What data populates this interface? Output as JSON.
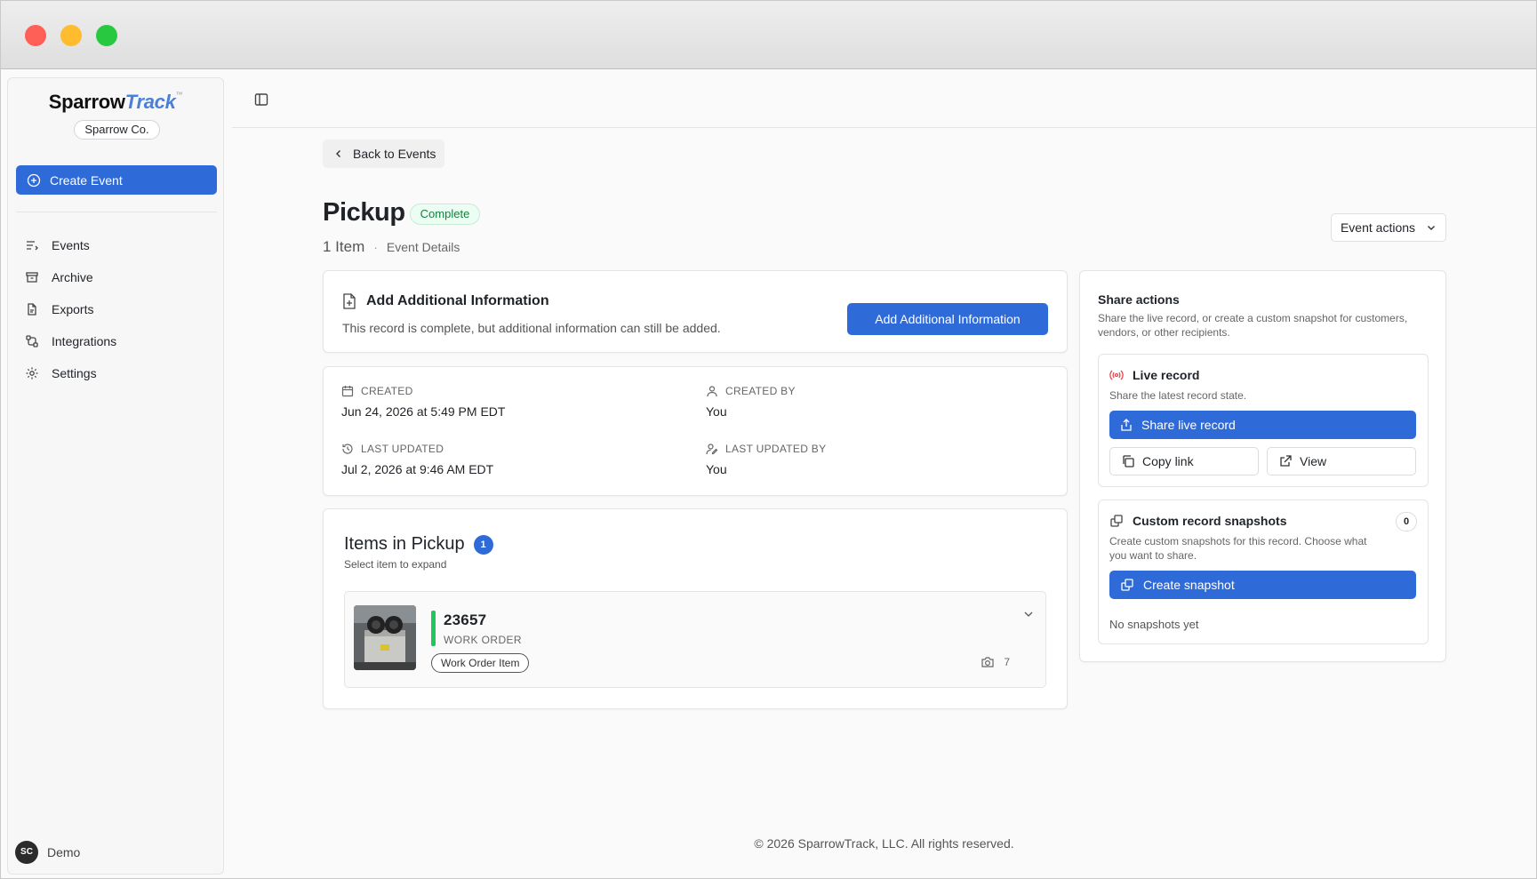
{
  "brand": {
    "name_part1": "Sparrow",
    "name_part2": "Track",
    "trademark": "™",
    "org": "Sparrow Co."
  },
  "sidebar": {
    "create_label": "Create Event",
    "items": [
      {
        "label": "Events",
        "icon": "list-icon"
      },
      {
        "label": "Archive",
        "icon": "archive-icon"
      },
      {
        "label": "Exports",
        "icon": "export-file-icon"
      },
      {
        "label": "Integrations",
        "icon": "integrations-icon"
      },
      {
        "label": "Settings",
        "icon": "gear-icon"
      }
    ],
    "user": {
      "initials": "SC",
      "name": "Demo"
    }
  },
  "header": {
    "back_label": "Back to Events",
    "title": "Pickup",
    "status": "Complete",
    "item_count": "1 Item",
    "separator": "·",
    "subtitle": "Event Details",
    "actions_label": "Event actions"
  },
  "info_card": {
    "title": "Add Additional Information",
    "description": "This record is complete, but additional information can still be added.",
    "button_label": "Add Additional Information"
  },
  "meta": {
    "created_label": "CREATED",
    "created_value": "Jun 24, 2026 at 5:49 PM EDT",
    "created_by_label": "CREATED BY",
    "created_by_value": "You",
    "updated_label": "LAST UPDATED",
    "updated_value": "Jul 2, 2026 at 9:46 AM EDT",
    "updated_by_label": "LAST UPDATED BY",
    "updated_by_value": "You"
  },
  "items": {
    "title": "Items in Pickup",
    "count": "1",
    "subtitle": "Select item to expand",
    "list": [
      {
        "number": "23657",
        "type": "WORK ORDER",
        "tag": "Work Order Item",
        "photos": "7"
      }
    ]
  },
  "share": {
    "title": "Share actions",
    "description": "Share the live record, or create a custom snapshot for customers, vendors, or other recipients.",
    "live": {
      "title": "Live record",
      "description": "Share the latest record state.",
      "share_label": "Share live record",
      "copy_label": "Copy link",
      "view_label": "View"
    },
    "snapshots": {
      "title": "Custom record snapshots",
      "count": "0",
      "description": "Create custom snapshots for this record. Choose what you want to share.",
      "create_label": "Create snapshot",
      "empty": "No snapshots yet"
    }
  },
  "footer": {
    "text": "© 2026 SparrowTrack, LLC. All rights reserved."
  },
  "colors": {
    "accent": "#2f6bd8",
    "success": "#22c55e",
    "live": "#e5484d",
    "badge_bg": "#ecfdf3"
  }
}
